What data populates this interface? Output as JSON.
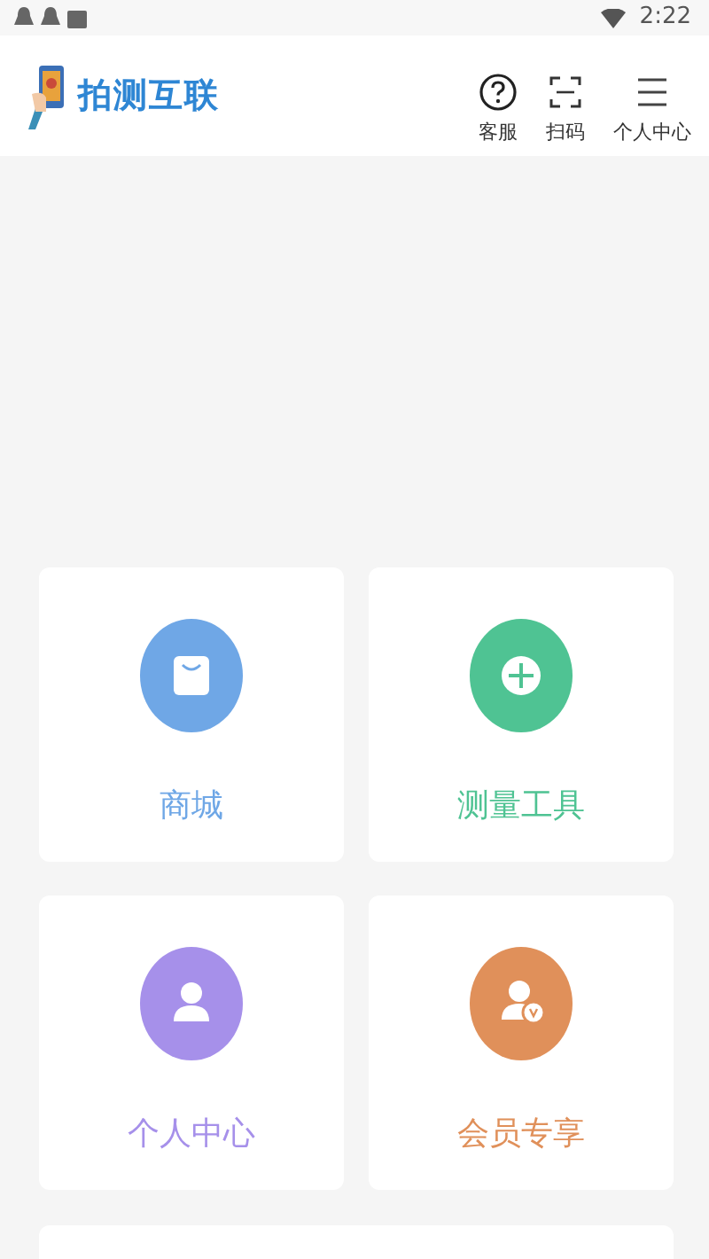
{
  "status_bar": {
    "time": "2:22"
  },
  "header": {
    "app_name": "拍测互联",
    "actions": [
      {
        "label": "客服",
        "kind": "help"
      },
      {
        "label": "扫码",
        "kind": "scan"
      },
      {
        "label": "个人中心",
        "kind": "menu"
      }
    ]
  },
  "tiles": [
    {
      "label": "商城",
      "kind": "bag",
      "color": "#6fa7e6"
    },
    {
      "label": "测量工具",
      "kind": "plus",
      "color": "#4fc393"
    },
    {
      "label": "个人中心",
      "kind": "person",
      "color": "#a690ea"
    },
    {
      "label": "会员专享",
      "kind": "vip",
      "color": "#e0905a"
    }
  ]
}
